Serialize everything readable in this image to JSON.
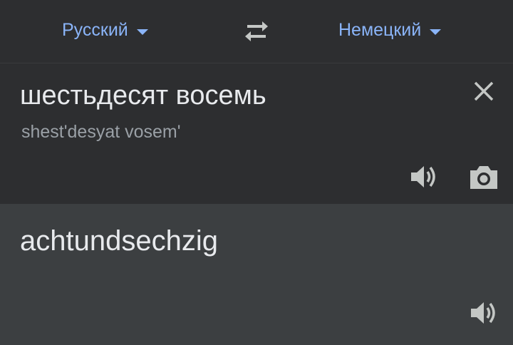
{
  "languages": {
    "source": "Русский",
    "target": "Немецкий"
  },
  "input": {
    "text": "шестьдесят восемь",
    "transliteration": "shest'desyat vosem'"
  },
  "output": {
    "text": "achtundsechzig"
  },
  "colors": {
    "accent": "#8ab4f8",
    "panel_top": "#2d2e30",
    "panel_result": "#3c3f41",
    "text_primary": "#e8eaed",
    "text_secondary": "#9aa0a6",
    "icon": "#c4c7c5"
  },
  "icons": [
    "swap-languages-icon",
    "close-icon",
    "speaker-icon",
    "camera-icon"
  ]
}
